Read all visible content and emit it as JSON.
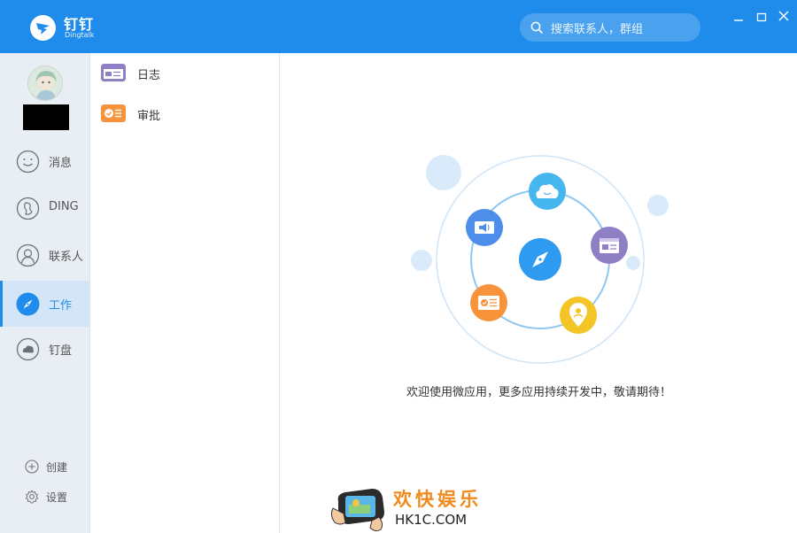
{
  "header": {
    "brand": "钉钉",
    "brand_sub": "Dingtalk",
    "search_placeholder": "搜索联系人，群组",
    "accent": "#1f8ceb"
  },
  "nav": {
    "items": [
      {
        "label": "消息",
        "icon": "message-smile-icon"
      },
      {
        "label": "DING",
        "icon": "ding-icon"
      },
      {
        "label": "联系人",
        "icon": "contacts-icon"
      },
      {
        "label": "工作",
        "icon": "compass-icon"
      },
      {
        "label": "钉盘",
        "icon": "cloud-drive-icon"
      }
    ],
    "active": "工作",
    "create_label": "创建",
    "settings_label": "设置"
  },
  "apps": [
    {
      "label": "日志",
      "icon": "log-icon",
      "color": "#8f7fc4"
    },
    {
      "label": "审批",
      "icon": "approval-icon",
      "color": "#f7933b"
    }
  ],
  "main": {
    "welcome_text": "欢迎使用微应用，更多应用持续开发中，敬请期待！",
    "illustration_icons": [
      "compass-icon",
      "cloud-icon",
      "announcement-icon",
      "calendar-icon",
      "approval-icon",
      "location-icon"
    ]
  },
  "watermark": {
    "title": "欢快娱乐",
    "url": "HK1C.COM"
  }
}
